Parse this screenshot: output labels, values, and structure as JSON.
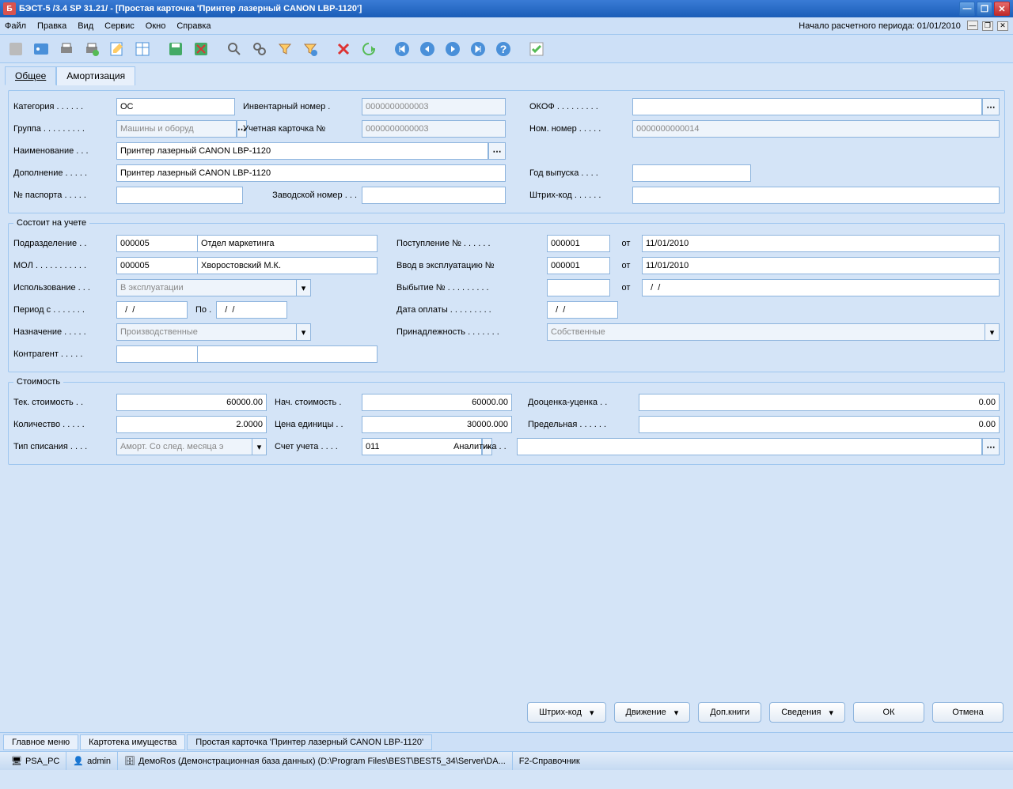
{
  "window": {
    "title": "БЭСТ-5 /3.4 SP 31.21/ - [Простая карточка 'Принтер лазерный CANON LBP-1120']"
  },
  "menu": {
    "items": [
      "Файл",
      "Правка",
      "Вид",
      "Сервис",
      "Окно",
      "Справка"
    ],
    "period_label": "Начало расчетного периода: 01/01/2010"
  },
  "tabs": {
    "general": "Общее",
    "amort": "Амортизация"
  },
  "header": {
    "lbl_category": "Категория . . . . . .",
    "category": "ОС",
    "lbl_invno": "Инвентарный номер .",
    "invno": "0000000000003",
    "lbl_okof": "ОКОФ . . . . . . . . .",
    "okof": "",
    "lbl_group": "Группа . . . . . . . . .",
    "group": "Машины и оборуд",
    "lbl_cardno": "Учетная карточка №",
    "cardno": "0000000000003",
    "lbl_nomno": "Ном. номер . . . . .",
    "nomno": "0000000000014",
    "lbl_name": "Наименование . . .",
    "name": "Принтер лазерный CANON LBP-1120",
    "lbl_addition": "Дополнение . . . . .",
    "addition": "Принтер лазерный CANON LBP-1120",
    "lbl_year": "Год выпуска . . . .",
    "year": "",
    "lbl_passport": "№ паспорта . . . . .",
    "passport": "",
    "lbl_factory": "Заводской номер . . .",
    "factory": "",
    "lbl_barcode": "Штрих-код . . . . . .",
    "barcode": ""
  },
  "reg": {
    "legend": "Состоит на учете",
    "lbl_dept": "Подразделение . .",
    "dept_code": "000005",
    "dept_name": "Отдел маркетинга",
    "lbl_mol": "МОЛ . . . . . . . . . . .",
    "mol_code": "000005",
    "mol_name": "Хворостовский М.К.",
    "lbl_use": "Использование . . .",
    "use": "В эксплуатации",
    "lbl_period": "Период с . . . . . . .",
    "period_from": "  /  /",
    "lbl_to": "По .",
    "period_to": "  /  /",
    "lbl_purpose": "Назначение . . . . .",
    "purpose": "Производственные",
    "lbl_contr": "Контрагент . . . . .",
    "contr_code": "",
    "contr_name": "",
    "lbl_receipt": "Поступление    № . . . . . .",
    "receipt_no": "000001",
    "lbl_from": "от",
    "receipt_date": "11/01/2010",
    "lbl_commiss": "Ввод в эксплуатацию   №",
    "commiss_no": "000001",
    "commiss_date": "11/01/2010",
    "lbl_disposal": "Выбытие   № . . . . . . . . .",
    "disposal_no": "",
    "disposal_date": "  /  /",
    "lbl_paydate": "Дата оплаты . . . . . . . . .",
    "paydate": "  /  /",
    "lbl_owner": "Принадлежность . . . . . . .",
    "owner": "Собственные"
  },
  "cost": {
    "legend": "Стоимость",
    "lbl_curcost": "Тек. стоимость . .",
    "curcost": "60000.00",
    "lbl_initcost": "Нач. стоимость .",
    "initcost": "60000.00",
    "lbl_reval": "Дооценка-уценка . .",
    "reval": "0.00",
    "lbl_qty": "Количество . . . . .",
    "qty": "2.0000",
    "lbl_price": "Цена единицы . .",
    "price": "30000.000",
    "lbl_limit": "Предельная . . . . . .",
    "limit": "0.00",
    "lbl_writeoff": "Тип списания . . . .",
    "writeoff": "Аморт. Со след. месяца э",
    "lbl_account": "Счет учета . . . .",
    "account": "011",
    "lbl_analytics": "Аналитика . .",
    "analytics": ""
  },
  "buttons": {
    "barcode": "Штрих-код",
    "movement": "Движение",
    "addbooks": "Доп.книги",
    "details": "Сведения",
    "ok": "ОК",
    "cancel": "Отмена"
  },
  "bottomtabs": {
    "main": "Главное меню",
    "card": "Картотека имущества",
    "current": "Простая карточка 'Принтер лазерный CANON LBP-1120'"
  },
  "status": {
    "pc": "PSA_PC",
    "user": "admin",
    "db": "ДемоRos (Демонстрационная база данных) (D:\\Program Files\\BEST\\BEST5_34\\Server\\DA...",
    "help": "F2-Справочник"
  }
}
